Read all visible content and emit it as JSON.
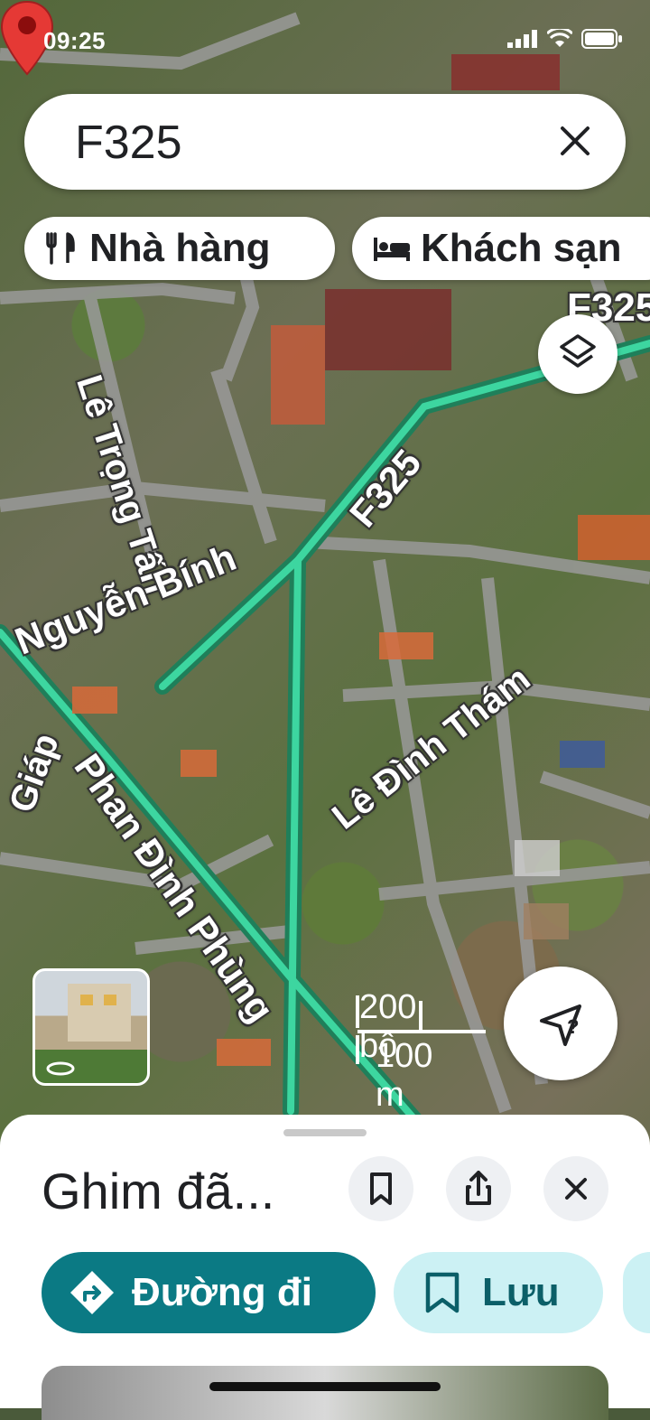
{
  "status_bar": {
    "time": "09:25"
  },
  "search": {
    "query": "F325"
  },
  "chips": [
    {
      "icon": "restaurant-icon",
      "label": "Nhà hàng"
    },
    {
      "icon": "hotel-icon",
      "label": "Khách sạn"
    }
  ],
  "map": {
    "street_labels": {
      "f325_top": "F325",
      "f325": "F325",
      "le_trong_tan": "Lê Trọng Tấn",
      "nguyen_binh": "Nguyễn Bính",
      "phan_dinh_phung": "Phan Đình Phùng",
      "le_dinh_tham": "Lê Đình Thám",
      "giap": "Giáp"
    },
    "scale": {
      "feet": "200 bộ",
      "meters": "100 m"
    },
    "accent_route_color": "#3dd6a0",
    "pin_color": "#e53935"
  },
  "sheet": {
    "title": "Ghim đã...",
    "buttons": {
      "directions": "Đường đi",
      "save": "Lưu"
    }
  }
}
